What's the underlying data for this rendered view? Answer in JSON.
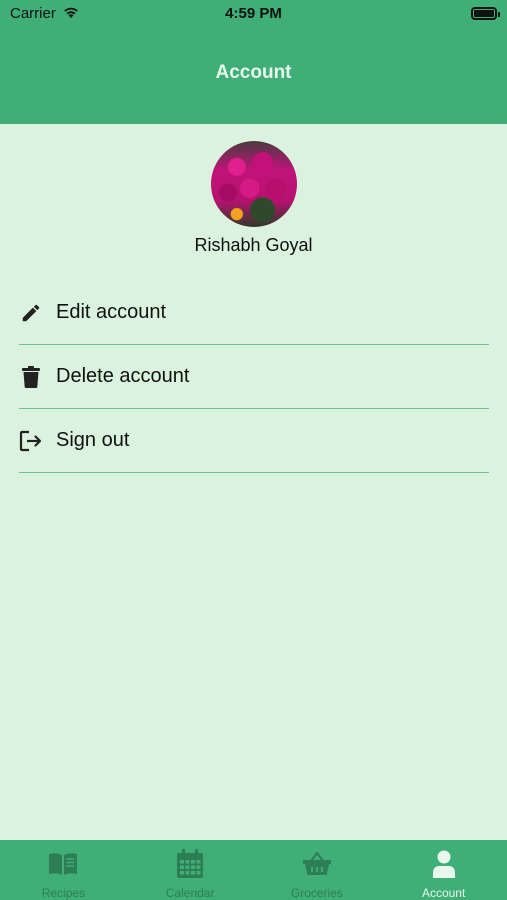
{
  "status_bar": {
    "carrier": "Carrier",
    "time": "4:59 PM"
  },
  "header": {
    "title": "Account"
  },
  "profile": {
    "name": "Rishabh Goyal"
  },
  "menu": {
    "items": [
      {
        "label": "Edit account",
        "icon": "pencil-icon"
      },
      {
        "label": "Delete account",
        "icon": "trash-icon"
      },
      {
        "label": "Sign out",
        "icon": "sign-out-icon"
      }
    ]
  },
  "tabbar": {
    "tabs": [
      {
        "label": "Recipes",
        "icon": "book-icon",
        "active": false
      },
      {
        "label": "Calendar",
        "icon": "calendar-icon",
        "active": false
      },
      {
        "label": "Groceries",
        "icon": "basket-icon",
        "active": false
      },
      {
        "label": "Account",
        "icon": "user-icon",
        "active": true
      }
    ]
  },
  "colors": {
    "primary": "#3fae77",
    "background": "#dbf2de",
    "divider": "#6cc495",
    "inactive_tab": "#2d7d55",
    "active_tab": "#e9f8ee"
  }
}
